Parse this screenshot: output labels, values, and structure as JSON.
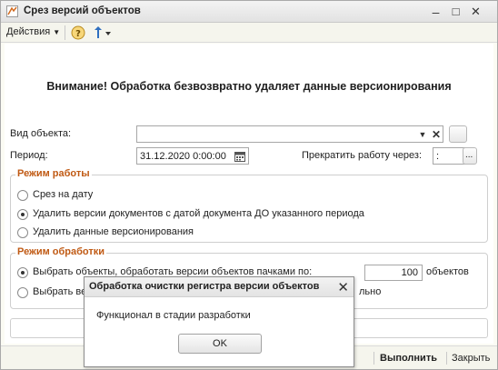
{
  "window": {
    "title": "Срез версий объектов",
    "minimize_glyph": "–",
    "maximize_glyph": "□",
    "close_glyph": "✕"
  },
  "toolbar": {
    "actions_label": "Действия",
    "help_glyph": "?",
    "actions_icon": "chevron-down-icon",
    "help_icon": "help-icon",
    "navigate_icon": "up-arrow-icon"
  },
  "main": {
    "warning": "Внимание! Обработка безвозвратно удаляет данные версионирования",
    "object_type": {
      "label": "Вид объекта:",
      "value": ""
    },
    "period": {
      "label": "Период:",
      "value": "31.12.2020  0:00:00"
    },
    "stop_after": {
      "label": "Прекратить работу через:",
      "value": " :"
    },
    "ellipsis": "..."
  },
  "work_mode": {
    "title": "Режим работы",
    "options": [
      {
        "label": "Срез на дату",
        "selected": false
      },
      {
        "label": "Удалить версии документов с датой документа ДО указанного периода",
        "selected": true
      },
      {
        "label": "Удалить данные версионирования",
        "selected": false
      }
    ]
  },
  "process_mode": {
    "title": "Режим обработки",
    "options": [
      {
        "label": "Выбрать объекты, обработать версии объектов пачками по:",
        "selected": true
      },
      {
        "label": "Выбрать ве",
        "tail": "льно",
        "selected": false
      }
    ],
    "batch_size": "100",
    "batch_unit": "объектов"
  },
  "footer": {
    "run_label": "Выполнить",
    "close_label": "Закрыть"
  },
  "dialog": {
    "title": "Обработка очистки регистра версии объектов",
    "message": "Функционал в стадии разработки",
    "ok_label": "OK",
    "close_glyph": "✕"
  },
  "colors": {
    "accent": "#c05a14",
    "window_bg": "#fbfbf4"
  }
}
